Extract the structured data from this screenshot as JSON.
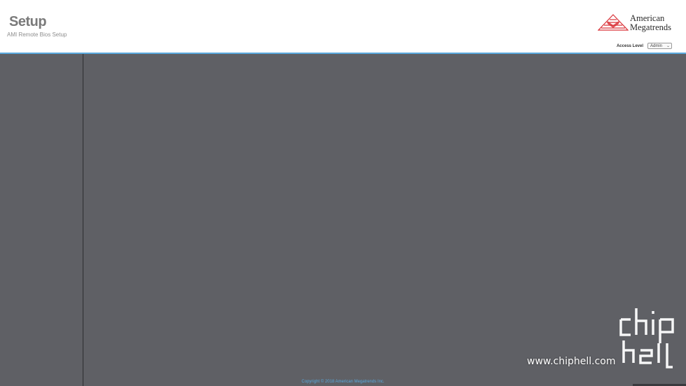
{
  "header": {
    "title": "Setup",
    "subtitle": "AMI Remote Bios Setup",
    "logo_line1": "American",
    "logo_line2": "Megatrends",
    "access_label": "Access Level",
    "access_value": "Admin"
  },
  "footer": {
    "copyright": "Copyright © 2018 American Megatrends Inc."
  },
  "watermark": {
    "url": "www.chiphell.com"
  },
  "colors": {
    "header_bg": "#ffffff",
    "header_border": "#5aa9de",
    "panel_bg": "#5f6065",
    "logo_red": "#d9343a",
    "footer_text": "#5aa9de"
  }
}
